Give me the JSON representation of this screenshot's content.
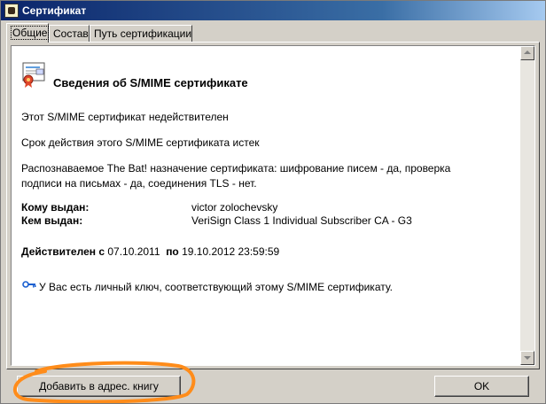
{
  "window": {
    "title": "Сертификат"
  },
  "tabs": [
    {
      "label": "Общие",
      "active": true
    },
    {
      "label": "Состав",
      "active": false
    },
    {
      "label": "Путь сертификации",
      "active": false
    }
  ],
  "general": {
    "heading": "Сведения об S/MIME сертификате",
    "status_invalid": "Этот S/MIME сертификат недействителен",
    "status_expired": "Срок действия этого S/MIME сертификата истек",
    "purpose_line1": "Распознаваемое The Bat! назначение сертификата: шифрование писем - да, проверка",
    "purpose_line2": "подписи на письмах - да, соединения TLS - нет.",
    "issued_to_label": "Кому выдан:",
    "issued_to_value": "victor zolochevsky",
    "issued_by_label": "Кем выдан:",
    "issued_by_value": "VeriSign Class 1 Individual Subscriber CA - G3",
    "valid_from_label": "Действителен с",
    "valid_from_value": "07.10.2011",
    "valid_to_label": "по",
    "valid_to_value": "19.10.2012 23:59:59",
    "private_key_note": "У Вас есть личный ключ, соответствующий этому S/MIME сертификату."
  },
  "buttons": {
    "add_to_address_book": "Добавить в адрес. книгу",
    "ok": "OK"
  },
  "colors": {
    "titlebar_start": "#0a246a",
    "titlebar_end": "#a6caf0",
    "annotation_orange": "#ff8c1a",
    "window_face": "#d4d0c8"
  },
  "icons": {
    "app": "the-bat-app-icon",
    "certificate": "certificate-icon",
    "key": "key-icon"
  }
}
